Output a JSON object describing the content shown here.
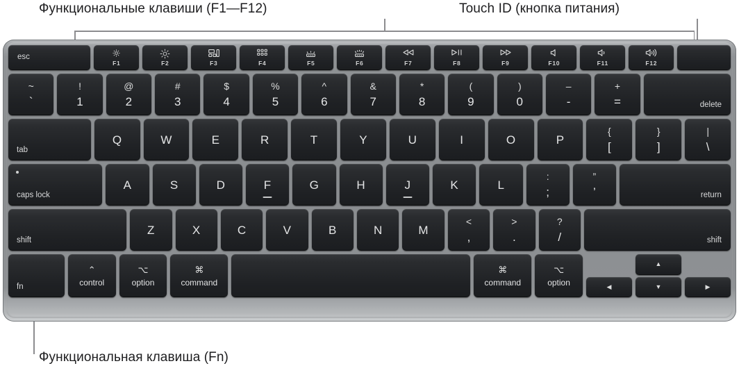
{
  "callouts": {
    "function_keys": "Функциональные клавиши (F1—F12)",
    "touch_id": "Touch ID (кнопка питания)",
    "fn_key": "Функциональная клавиша (Fn)"
  },
  "colors": {
    "body": "#8a8d90",
    "key": "#202225",
    "key_text": "#e4e5e6",
    "leader": "#8c8c8f",
    "label_text": "#1d1d1f"
  },
  "keyboard": {
    "layout": "US ANSI — MacBook Air / Pro Magic Keyboard",
    "function_row": [
      {
        "label": "esc",
        "icon": "",
        "fnum": "",
        "type": "word"
      },
      {
        "label": "",
        "icon": "brightness-down-icon",
        "fnum": "F1",
        "type": "fn"
      },
      {
        "label": "",
        "icon": "brightness-up-icon",
        "fnum": "F2",
        "type": "fn"
      },
      {
        "label": "",
        "icon": "mission-control-icon",
        "fnum": "F3",
        "type": "fn"
      },
      {
        "label": "",
        "icon": "spotlight-grid-icon",
        "fnum": "F4",
        "type": "fn"
      },
      {
        "label": "",
        "icon": "keyboard-backlight-down-icon",
        "fnum": "F5",
        "type": "fn"
      },
      {
        "label": "",
        "icon": "keyboard-backlight-up-icon",
        "fnum": "F6",
        "type": "fn"
      },
      {
        "label": "",
        "icon": "rewind-icon",
        "fnum": "F7",
        "type": "fn"
      },
      {
        "label": "",
        "icon": "play-pause-icon",
        "fnum": "F8",
        "type": "fn"
      },
      {
        "label": "",
        "icon": "fast-forward-icon",
        "fnum": "F9",
        "type": "fn"
      },
      {
        "label": "",
        "icon": "volume-mute-icon",
        "fnum": "F10",
        "type": "fn"
      },
      {
        "label": "",
        "icon": "volume-down-icon",
        "fnum": "F11",
        "type": "fn"
      },
      {
        "label": "",
        "icon": "volume-up-icon",
        "fnum": "F12",
        "type": "fn"
      },
      {
        "label": "",
        "icon": "touch-id-icon",
        "fnum": "",
        "type": "blank"
      }
    ],
    "number_row": [
      {
        "top": "~",
        "bottom": "`"
      },
      {
        "top": "!",
        "bottom": "1"
      },
      {
        "top": "@",
        "bottom": "2"
      },
      {
        "top": "#",
        "bottom": "3"
      },
      {
        "top": "$",
        "bottom": "4"
      },
      {
        "top": "%",
        "bottom": "5"
      },
      {
        "top": "^",
        "bottom": "6"
      },
      {
        "top": "&",
        "bottom": "7"
      },
      {
        "top": "*",
        "bottom": "8"
      },
      {
        "top": "(",
        "bottom": "9"
      },
      {
        "top": ")",
        "bottom": "0"
      },
      {
        "top": "–",
        "bottom": "-"
      },
      {
        "top": "+",
        "bottom": "="
      },
      {
        "word": "delete"
      }
    ],
    "qwerty_row": [
      {
        "word": "tab"
      },
      {
        "letter": "Q"
      },
      {
        "letter": "W"
      },
      {
        "letter": "E"
      },
      {
        "letter": "R"
      },
      {
        "letter": "T"
      },
      {
        "letter": "Y"
      },
      {
        "letter": "U"
      },
      {
        "letter": "I"
      },
      {
        "letter": "O"
      },
      {
        "letter": "P"
      },
      {
        "top": "{",
        "bottom": "["
      },
      {
        "top": "}",
        "bottom": "]"
      },
      {
        "top": "|",
        "bottom": "\\"
      }
    ],
    "home_row": [
      {
        "word": "caps lock",
        "indicator": true
      },
      {
        "letter": "A"
      },
      {
        "letter": "S"
      },
      {
        "letter": "D"
      },
      {
        "letter": "F",
        "homing": true
      },
      {
        "letter": "G"
      },
      {
        "letter": "H"
      },
      {
        "letter": "J",
        "homing": true
      },
      {
        "letter": "K"
      },
      {
        "letter": "L"
      },
      {
        "top": ":",
        "bottom": ";"
      },
      {
        "top": "”",
        "bottom": "’"
      },
      {
        "word": "return"
      }
    ],
    "shift_row": [
      {
        "word": "shift"
      },
      {
        "letter": "Z"
      },
      {
        "letter": "X"
      },
      {
        "letter": "C"
      },
      {
        "letter": "V"
      },
      {
        "letter": "B"
      },
      {
        "letter": "N"
      },
      {
        "letter": "M"
      },
      {
        "top": "<",
        "bottom": ","
      },
      {
        "top": ">",
        "bottom": "."
      },
      {
        "top": "?",
        "bottom": "/"
      },
      {
        "word": "shift"
      }
    ],
    "bottom_row": [
      {
        "word": "fn",
        "symbol": ""
      },
      {
        "word": "control",
        "symbol": "⌃"
      },
      {
        "word": "option",
        "symbol": "⌥"
      },
      {
        "word": "command",
        "symbol": "⌘"
      },
      {
        "word": "",
        "symbol": "",
        "name": "space"
      },
      {
        "word": "command",
        "symbol": "⌘"
      },
      {
        "word": "option",
        "symbol": "⌥"
      }
    ],
    "arrow_keys": {
      "left": "◀",
      "up": "▲",
      "down": "▼",
      "right": "▶"
    }
  }
}
